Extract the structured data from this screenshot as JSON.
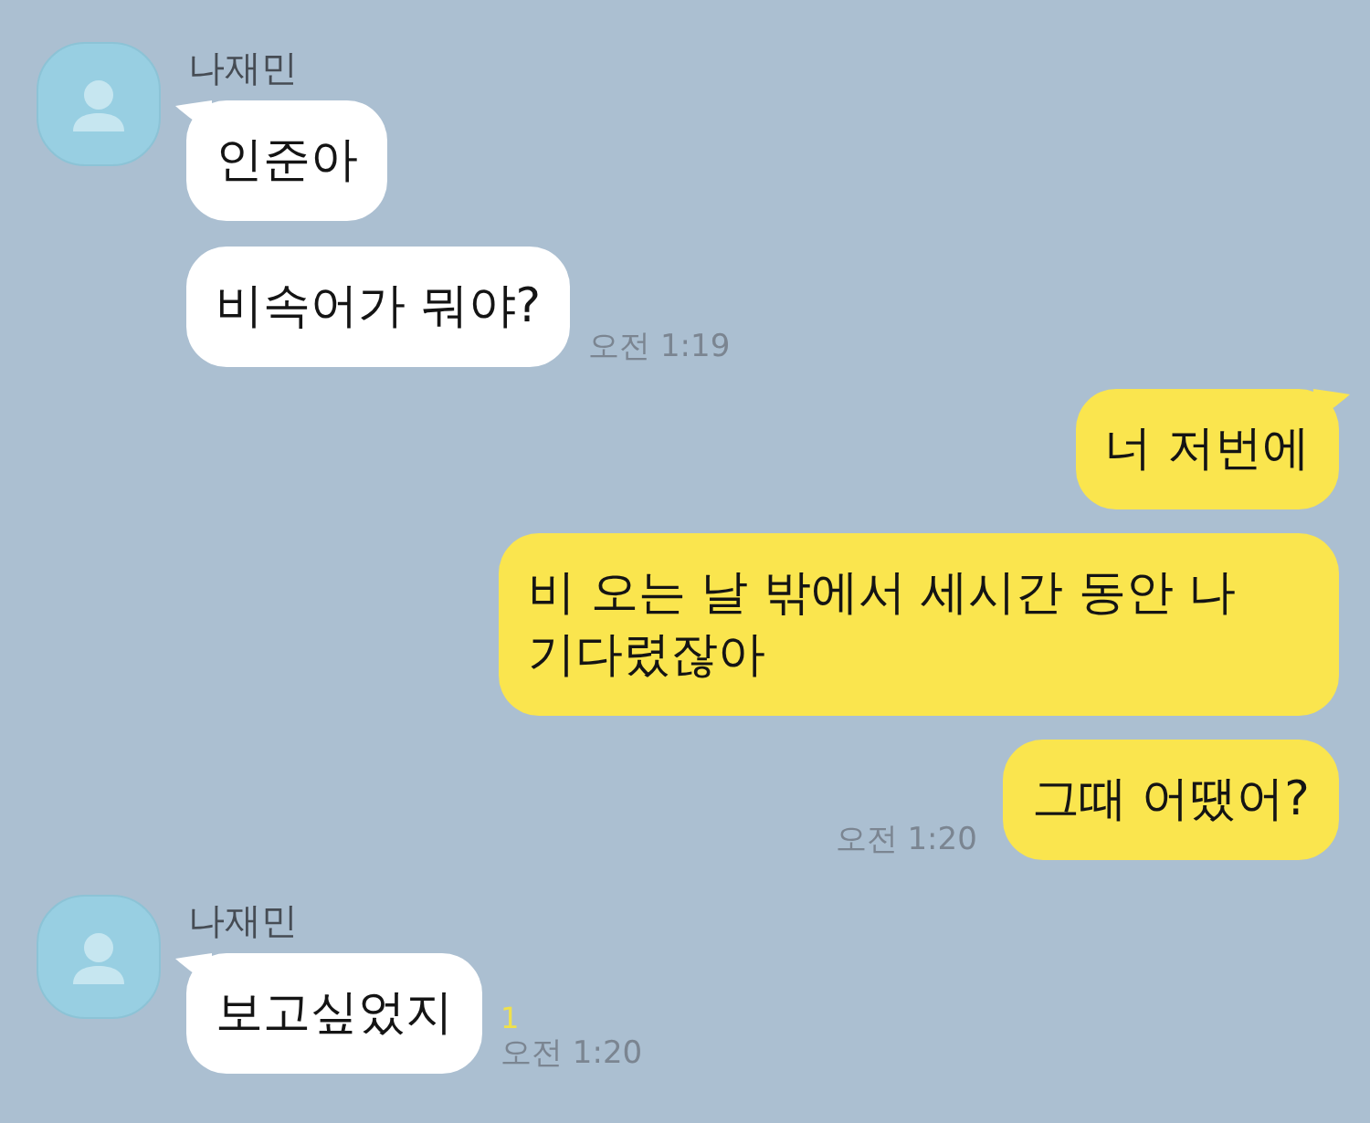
{
  "chat": {
    "messages": [
      {
        "kind": "received",
        "sender": "나재민",
        "bubbles": [
          {
            "text": "인준아"
          },
          {
            "text": "비속어가 뭐야?",
            "time": "오전 1:19"
          }
        ]
      },
      {
        "kind": "sent",
        "bubbles": [
          {
            "text": "너 저번에"
          },
          {
            "text": "비 오는 날 밖에서 세시간 동안 나 기다렸잖아"
          },
          {
            "text": "그때 어땠어?",
            "time": "오전 1:20"
          }
        ]
      },
      {
        "kind": "received",
        "sender": "나재민",
        "bubbles": [
          {
            "text": "보고싶었지",
            "unread": "1",
            "time": "오전 1:20"
          }
        ]
      }
    ]
  }
}
